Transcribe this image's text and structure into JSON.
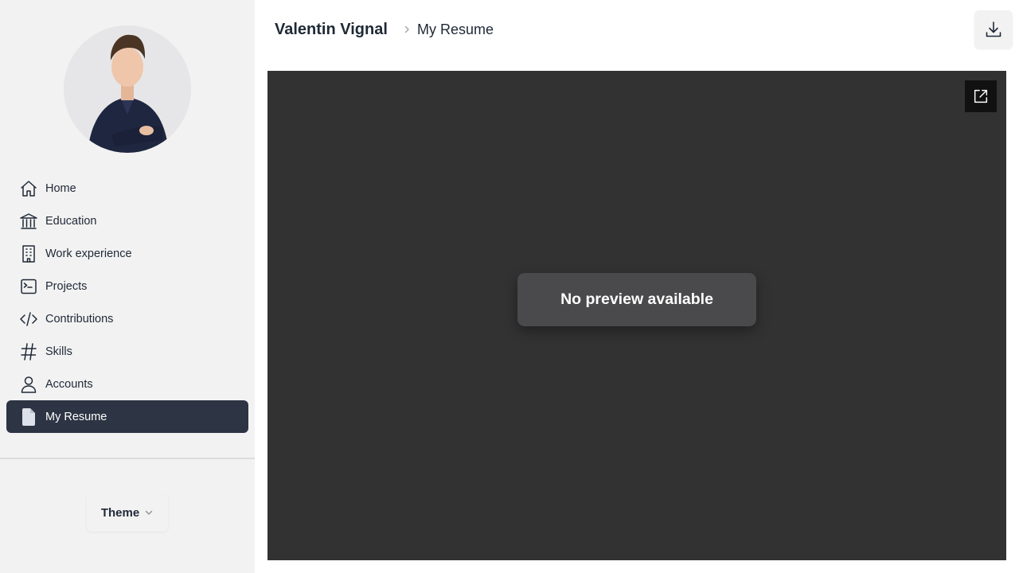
{
  "profile": {
    "avatar_icon": "profile-photo"
  },
  "sidebar": {
    "items": [
      {
        "label": "Home",
        "icon": "home-icon"
      },
      {
        "label": "Education",
        "icon": "institution-icon"
      },
      {
        "label": "Work experience",
        "icon": "building-icon"
      },
      {
        "label": "Projects",
        "icon": "terminal-icon"
      },
      {
        "label": "Contributions",
        "icon": "code-icon"
      },
      {
        "label": "Skills",
        "icon": "hashtag-icon"
      },
      {
        "label": "Accounts",
        "icon": "user-icon"
      },
      {
        "label": "My Resume",
        "icon": "document-icon",
        "active": true
      }
    ],
    "theme_label": "Theme"
  },
  "header": {
    "breadcrumb_root": "Valentin Vignal",
    "breadcrumb_current": "My Resume",
    "download_icon": "download-icon"
  },
  "viewer": {
    "message": "No preview available",
    "open_icon": "open-external-icon"
  },
  "colors": {
    "sidebar_bg": "#f2f2f2",
    "active_bg": "#2d3443",
    "viewer_bg": "#323232",
    "toast_bg": "#4a494b",
    "text": "#1f2937"
  }
}
